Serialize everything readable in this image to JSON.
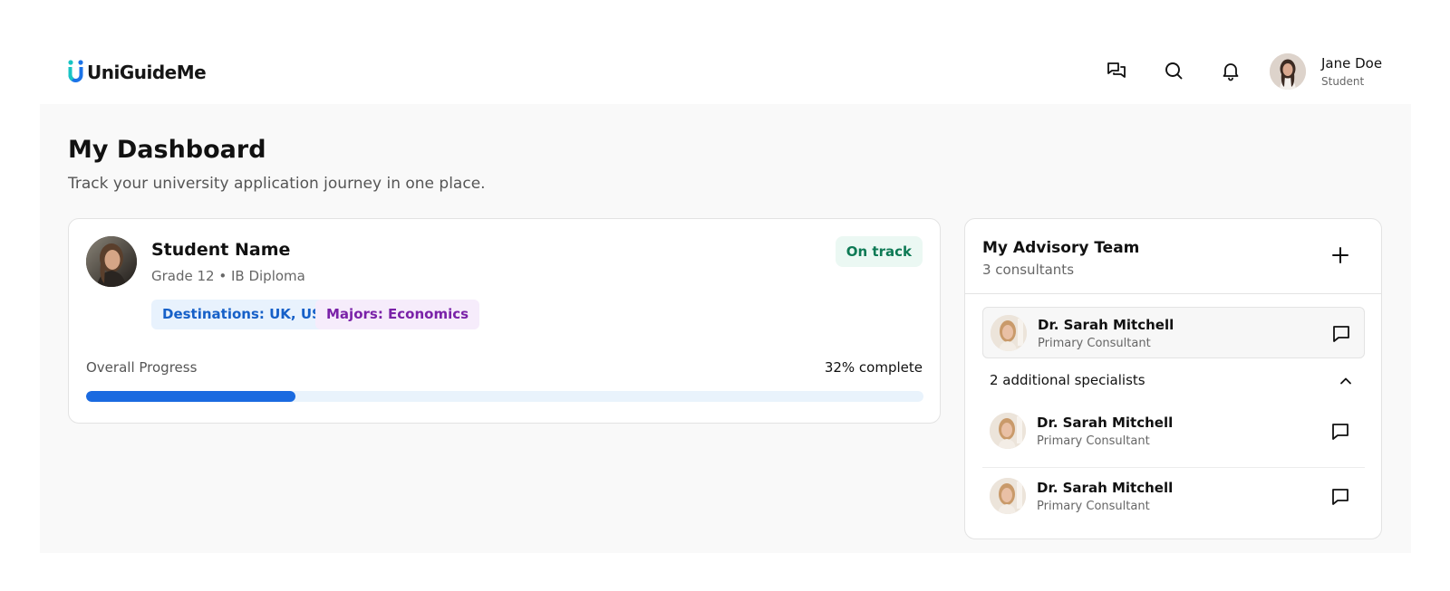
{
  "header": {
    "logo_text": "UniGuideMe",
    "brand_colors": {
      "blue": "#1b73e8",
      "teal": "#18c4c4"
    },
    "icons": [
      "chat-icon",
      "search-icon",
      "bell-icon"
    ],
    "user": {
      "name": "Jane Doe",
      "role": "Student"
    }
  },
  "page": {
    "title": "My Dashboard",
    "subtitle": "Track your university application journey in one place."
  },
  "student": {
    "name": "Student Name",
    "grade": "Grade 12 • IB Diploma",
    "status": "On track",
    "tags": {
      "destinations": "Destinations: UK, US",
      "majors": "Majors: Economics"
    },
    "progress": {
      "label": "Overall Progress",
      "value_text": "32% complete",
      "percent": 25
    }
  },
  "team": {
    "title": "My Advisory Team",
    "count": "3 consultants",
    "primary": {
      "name": "Dr. Sarah Mitchell",
      "role": "Primary Consultant"
    },
    "specialists_label": "2 additional specialists",
    "specialists": [
      {
        "name": "Dr. Sarah Mitchell",
        "role": "Primary Consultant"
      },
      {
        "name": "Dr. Sarah Mitchell",
        "role": "Primary Consultant"
      }
    ]
  }
}
